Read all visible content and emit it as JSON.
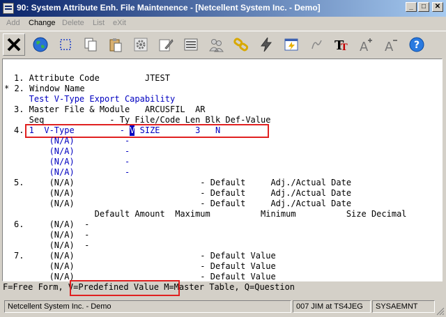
{
  "window": {
    "title": "90: System Attribute Enh. File Maintenence - [Netcellent System Inc. - Demo]",
    "minimize_glyph": "_",
    "maximize_glyph": "□",
    "close_glyph": "✕"
  },
  "menu": {
    "add": "Add",
    "change": "Change",
    "delete": "Delete",
    "list": "List",
    "exit": "eXit"
  },
  "toolbar_icons": [
    "cancel-icon",
    "globe-icon",
    "select-icon",
    "copy-icon",
    "paste-icon",
    "settings-gear-icon",
    "edit-form-icon",
    "list-icon",
    "users-icon",
    "links-icon",
    "lightning-icon",
    "window-lightning-icon",
    "script-icon",
    "text-size-icon",
    "font-increase-icon",
    "font-decrease-icon",
    "help-icon"
  ],
  "screen": {
    "line1": "1. Attribute Code         JTEST",
    "line2": "* 2. Window Name",
    "line3": "   Test V-Type Export Capability",
    "line4": "3. Master File & Module   ARCUSFIL  AR",
    "line5": "   Seq             - Ty File/Code Len Blk Def-Value",
    "line6_prefix": "4.",
    "line6_seq": " 1  V-Type         - ",
    "line6_ty": "V",
    "line6_rest": " SIZE       3   N",
    "line7": "       (N/A)          -",
    "line8": "       (N/A)          -",
    "line9": "       (N/A)          -",
    "line10": "       (N/A)          -",
    "line11": "5.     (N/A)                         - Default     Adj./Actual Date",
    "line12": "       (N/A)                         - Default     Adj./Actual Date",
    "line13": "       (N/A)                         - Default     Adj./Actual Date",
    "line14": "                Default Amount  Maximum          Minimum          Size Decimal",
    "line15": "6.     (N/A)  -",
    "line16": "       (N/A)  -",
    "line17": "       (N/A)  -",
    "line18": "7.     (N/A)                         - Default Value",
    "line19": "       (N/A)                         - Default Value",
    "line20": "       (N/A)                         - Default Value"
  },
  "help_line": {
    "part1": "F=Free Form, ",
    "part2": "V=Predefined Value",
    "part3": " M=Master Table, Q=Question"
  },
  "statusbar": {
    "company": "Netcellent System Inc. - Demo",
    "user": "007 JIM at TS4JEG",
    "program": "SYSAEMNT"
  }
}
